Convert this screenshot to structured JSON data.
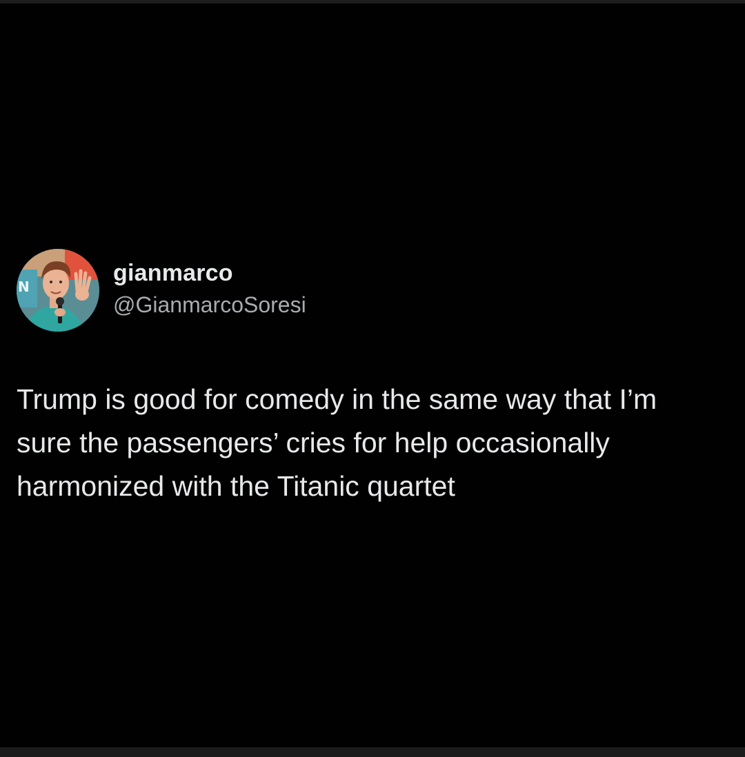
{
  "tweet": {
    "author": {
      "display_name": "gianmarco",
      "handle": "@GianmarcoSoresi",
      "avatar_icon": "profile-photo"
    },
    "text": "Trump is good for comedy in the same way that I’m\nsure the passengers’ cries for help occasionally\nharmonized with the Titanic quartet"
  },
  "colors": {
    "background": "#010101",
    "primary_text": "#e7e9ea",
    "secondary_text": "#a8acb0"
  }
}
